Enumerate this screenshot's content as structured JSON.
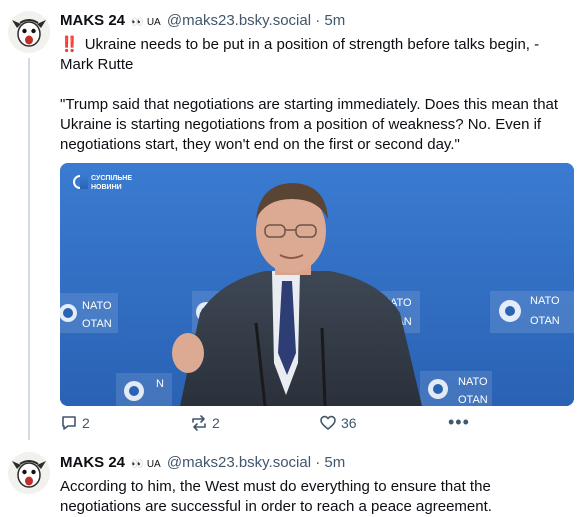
{
  "posts": [
    {
      "author": {
        "name": "MAKS 24",
        "badge_icons": "👀",
        "country": "UA",
        "handle": "@maks23.bsky.social",
        "separator": "·",
        "time": "5m"
      },
      "alert_icon": "‼️",
      "text": "Ukraine needs to be put in a position of strength before talks begin, - Mark Rutte\n\n\"Trump said that negotiations are starting immediately. Does this mean that Ukraine is starting negotiations from a position of weakness? No. Even if negotiations start, they won't end on the first or second day.\"",
      "media": {
        "channel_label_line1": "СУСПІЛЬНЕ",
        "channel_label_line2": "НОВИНИ",
        "backdrop_text_top": "NATO",
        "backdrop_text_bottom": "OTAN",
        "backdrop_color": "#2f6fc6"
      },
      "actions": {
        "reply_icon": "reply-icon",
        "reply_count": "2",
        "repost_icon": "repost-icon",
        "repost_count": "2",
        "like_icon": "heart-icon",
        "like_count": "36",
        "more_icon": "more-options-icon",
        "more_label": "•••"
      }
    },
    {
      "author": {
        "name": "MAKS 24",
        "badge_icons": "👀",
        "country": "UA",
        "handle": "@maks23.bsky.social",
        "separator": "·",
        "time": "5m"
      },
      "text": "According to him, the West must do everything to ensure that the negotiations are successful in order to reach a peace agreement."
    }
  ]
}
